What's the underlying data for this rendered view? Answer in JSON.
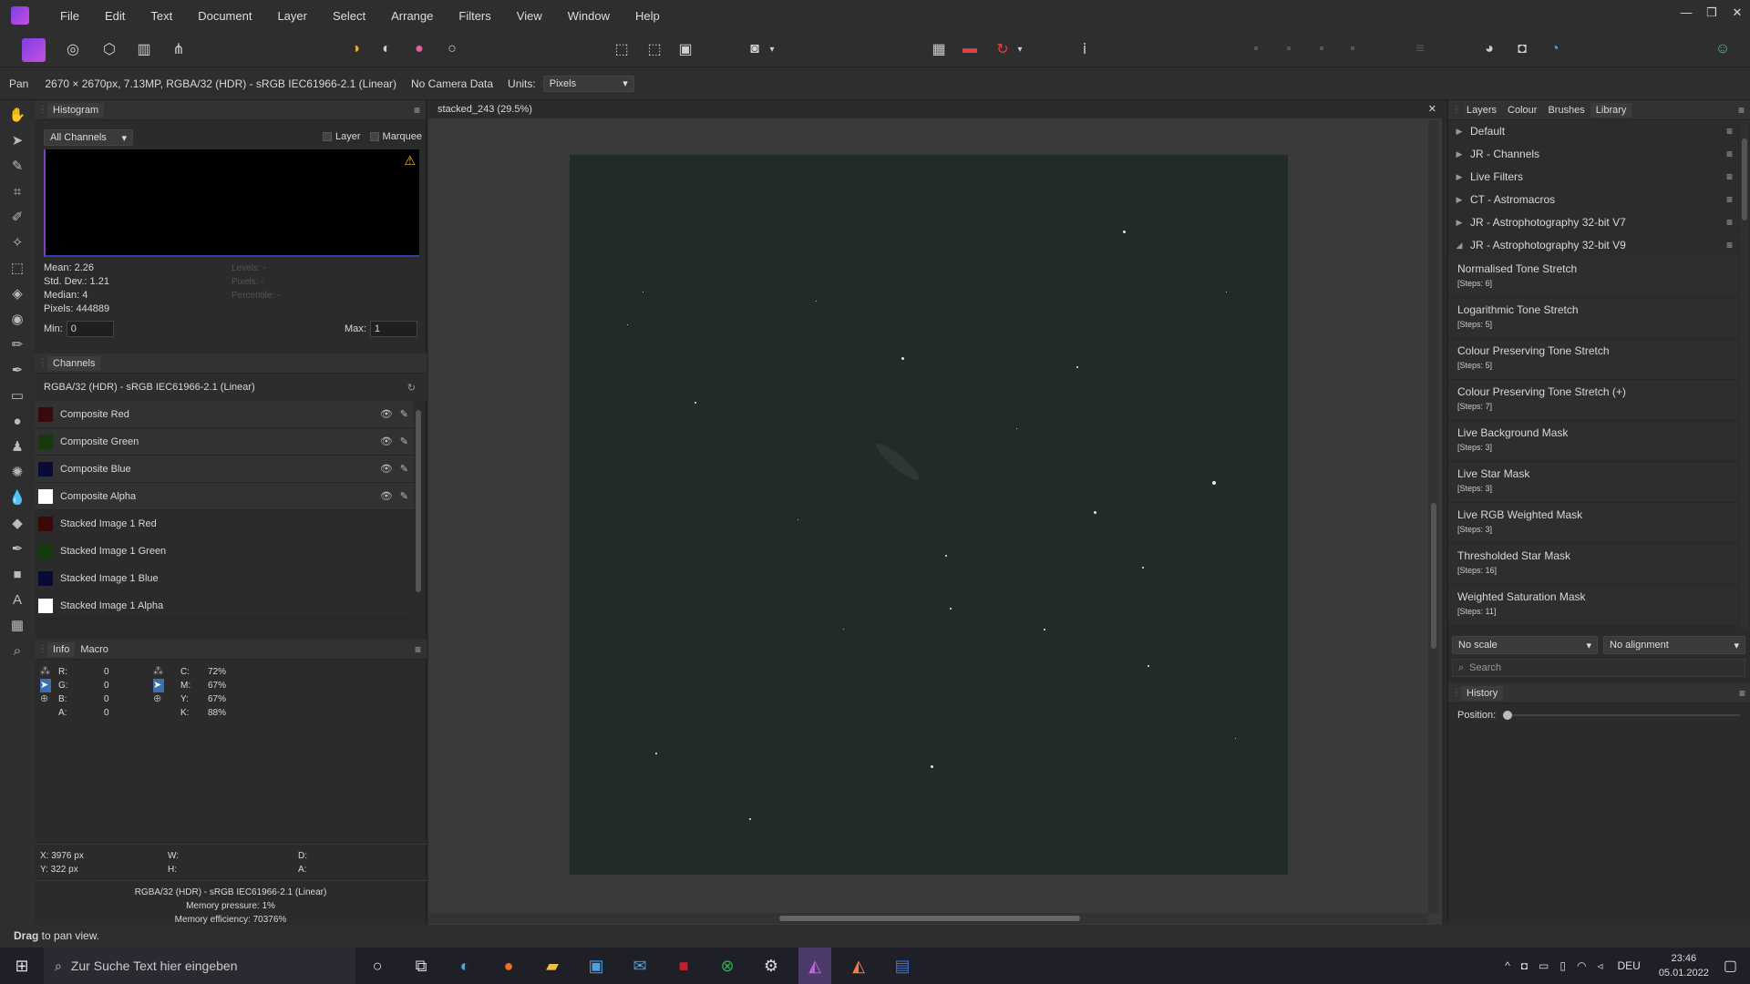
{
  "menu": [
    "File",
    "Edit",
    "Text",
    "Document",
    "Layer",
    "Select",
    "Arrange",
    "Filters",
    "View",
    "Window",
    "Help"
  ],
  "window_controls": {
    "minimize": "—",
    "restore": "❐",
    "close": "✕"
  },
  "context": {
    "tool": "Pan",
    "doc_info": "2670 × 2670px, 7.13MP, RGBA/32 (HDR) - sRGB IEC61966-2.1 (Linear)",
    "camera": "No Camera Data",
    "units_label": "Units:",
    "units_value": "Pixels"
  },
  "histogram": {
    "tab": "Histogram",
    "channel_select": "All Channels",
    "layer_label": "Layer",
    "marquee_label": "Marquee",
    "mean": "Mean: 2.26",
    "std": "Std. Dev.: 1.21",
    "median": "Median: 4",
    "pixels": "Pixels: 444889",
    "levels": "Levels: -",
    "pixels_r": "Pixels: -",
    "percentile": "Percentile: -",
    "min_label": "Min:",
    "min_value": "0",
    "max_label": "Max:",
    "max_value": "1"
  },
  "channels": {
    "tab": "Channels",
    "profile": "RGBA/32 (HDR) - sRGB IEC61966-2.1 (Linear)",
    "items": [
      {
        "label": "Composite Red",
        "color": "#3a0a0a"
      },
      {
        "label": "Composite Green",
        "color": "#173a0c"
      },
      {
        "label": "Composite Blue",
        "color": "#0a0a36"
      },
      {
        "label": "Composite Alpha",
        "color": "#ffffff"
      },
      {
        "label": "Stacked Image 1 Red",
        "color": "#3a0a0a"
      },
      {
        "label": "Stacked Image 1 Green",
        "color": "#173a0c"
      },
      {
        "label": "Stacked Image 1 Blue",
        "color": "#0a0a36"
      },
      {
        "label": "Stacked Image 1 Alpha",
        "color": "#ffffff"
      }
    ]
  },
  "info": {
    "tab_info": "Info",
    "tab_macro": "Macro",
    "rgb": [
      {
        "k": "R:",
        "v": "0"
      },
      {
        "k": "G:",
        "v": "0"
      },
      {
        "k": "B:",
        "v": "0"
      },
      {
        "k": "A:",
        "v": "0"
      }
    ],
    "cmyk": [
      {
        "k": "C:",
        "v": "72%"
      },
      {
        "k": "M:",
        "v": "67%"
      },
      {
        "k": "Y:",
        "v": "67%"
      },
      {
        "k": "K:",
        "v": "88%"
      }
    ],
    "x": "X: 3976 px",
    "y": "Y: 322 px",
    "w": "W:",
    "h": "H:",
    "d": "D:",
    "a": "A:",
    "profile": "RGBA/32 (HDR) - sRGB IEC61966-2.1 (Linear)",
    "pressure": "Memory pressure: 1%",
    "efficiency": "Memory efficiency: 70376%"
  },
  "document": {
    "tab": "stacked_243 (29.5%)"
  },
  "right": {
    "tabs": [
      "Layers",
      "Colour",
      "Brushes",
      "Library"
    ],
    "categories": [
      "Default",
      "JR - Channels",
      "Live Filters",
      "CT - Astromacros",
      "JR - Astrophotography 32-bit V7",
      "JR - Astrophotography 32-bit V9"
    ],
    "macros": [
      {
        "name": "Normalised Tone Stretch",
        "steps": "[Steps: 6]"
      },
      {
        "name": "Logarithmic Tone Stretch",
        "steps": "[Steps: 5]"
      },
      {
        "name": "Colour Preserving Tone Stretch",
        "steps": "[Steps: 5]"
      },
      {
        "name": "Colour Preserving Tone Stretch (+)",
        "steps": "[Steps: 7]"
      },
      {
        "name": "Live Background Mask",
        "steps": "[Steps: 3]"
      },
      {
        "name": "Live Star Mask",
        "steps": "[Steps: 3]"
      },
      {
        "name": "Live RGB Weighted Mask",
        "steps": "[Steps: 3]"
      },
      {
        "name": "Thresholded Star Mask",
        "steps": "[Steps: 16]"
      },
      {
        "name": "Weighted Saturation Mask",
        "steps": "[Steps: 11]"
      }
    ],
    "scale": "No scale",
    "alignment": "No alignment",
    "search_placeholder": "Search",
    "history_tab": "History",
    "position_label": "Position:"
  },
  "status": {
    "bold": "Drag",
    "rest": " to pan view."
  },
  "taskbar": {
    "search_placeholder": "Zur Suche Text hier eingeben",
    "lang": "DEU",
    "time": "23:46",
    "date": "05.01.2022"
  }
}
